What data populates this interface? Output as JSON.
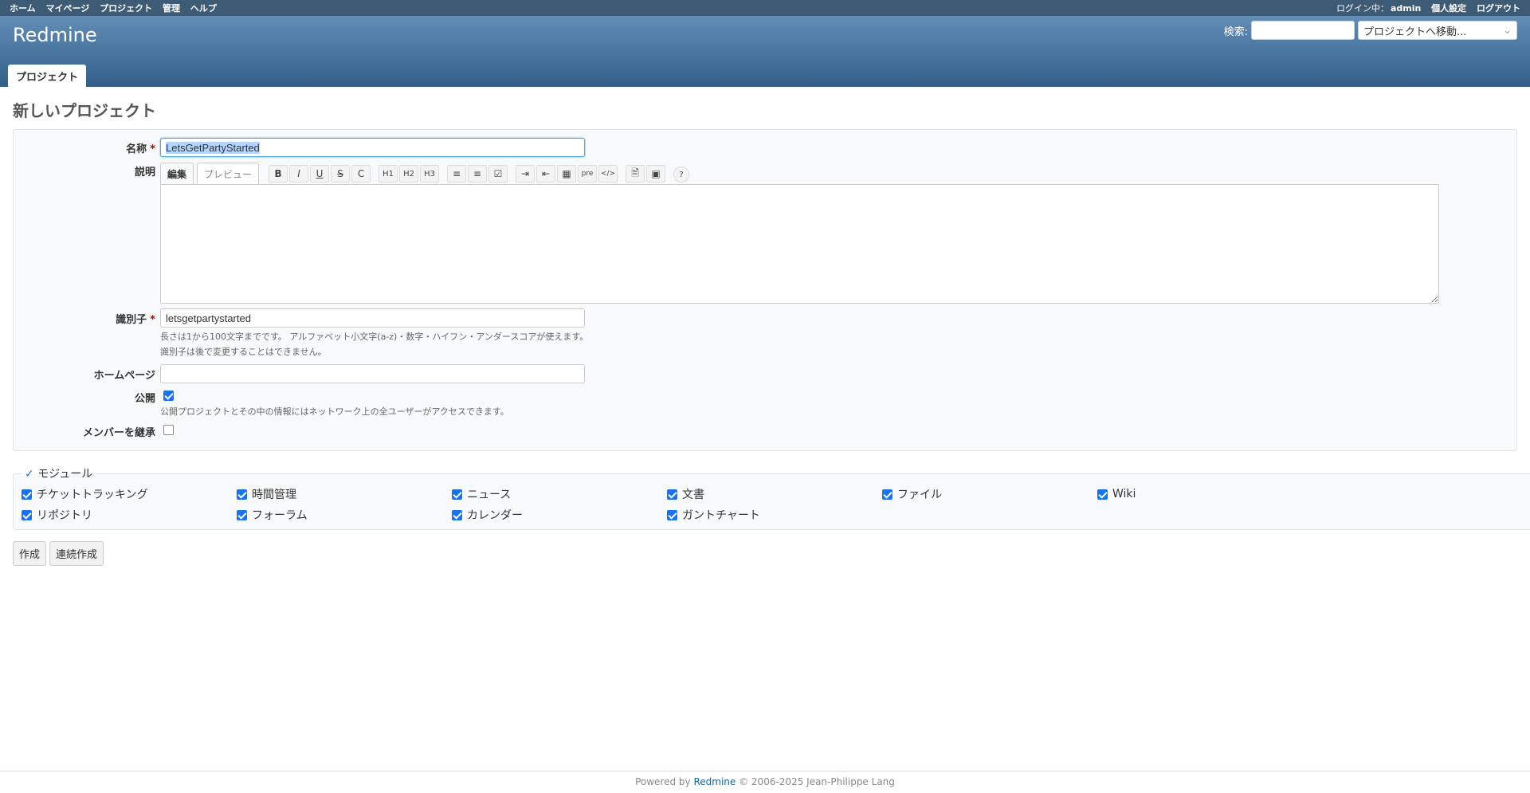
{
  "top_menu": {
    "left": [
      "ホーム",
      "マイページ",
      "プロジェクト",
      "管理",
      "ヘルプ"
    ],
    "login_prefix": "ログイン中：",
    "user": "admin",
    "my_account": "個人設定",
    "logout": "ログアウト"
  },
  "header": {
    "title": "Redmine",
    "search_label": "検索:",
    "jump_placeholder": "プロジェクトへ移動...",
    "tab": "プロジェクト"
  },
  "page": {
    "title": "新しいプロジェクト",
    "name_label": "名称",
    "required_mark": "*",
    "name_value": "LetsGetPartyStarted",
    "desc_label": "説明",
    "edit_tab": "編集",
    "preview_tab": "プレビュー",
    "toolbar": {
      "bold": "B",
      "italic": "I",
      "underline": "U",
      "strike": "S",
      "code": "C",
      "h1": "H1",
      "h2": "H2",
      "h3": "H3",
      "ul": "≡",
      "ol": "≡",
      "tl": "☑",
      "indent": "⇥",
      "outdent": "⇤",
      "table": "▦",
      "pre": "pre",
      "codeblock": "</>",
      "link": "🗎",
      "image": "▣",
      "help": "?"
    },
    "identifier_label": "識別子",
    "identifier_value": "letsgetpartystarted",
    "identifier_hint1": "長さは1から100文字までです。 アルファベット小文字(a-z)・数字・ハイフン・アンダースコアが使えます。",
    "identifier_hint2": "識別子は後で変更することはできません。",
    "homepage_label": "ホームページ",
    "homepage_value": "",
    "public_label": "公開",
    "public_hint": "公開プロジェクトとその中の情報にはネットワーク上の全ユーザーがアクセスできます。",
    "inherit_label": "メンバーを継承",
    "modules_legend": "モジュール",
    "modules": [
      "チケットトラッキング",
      "時間管理",
      "ニュース",
      "文書",
      "ファイル",
      "Wiki",
      "リポジトリ",
      "フォーラム",
      "カレンダー",
      "ガントチャート"
    ],
    "create_button": "作成",
    "create_continue_button": "連続作成"
  },
  "footer": {
    "powered_by": "Powered by",
    "redmine": "Redmine",
    "copyright": "© 2006-2025 Jean-Philippe Lang"
  }
}
